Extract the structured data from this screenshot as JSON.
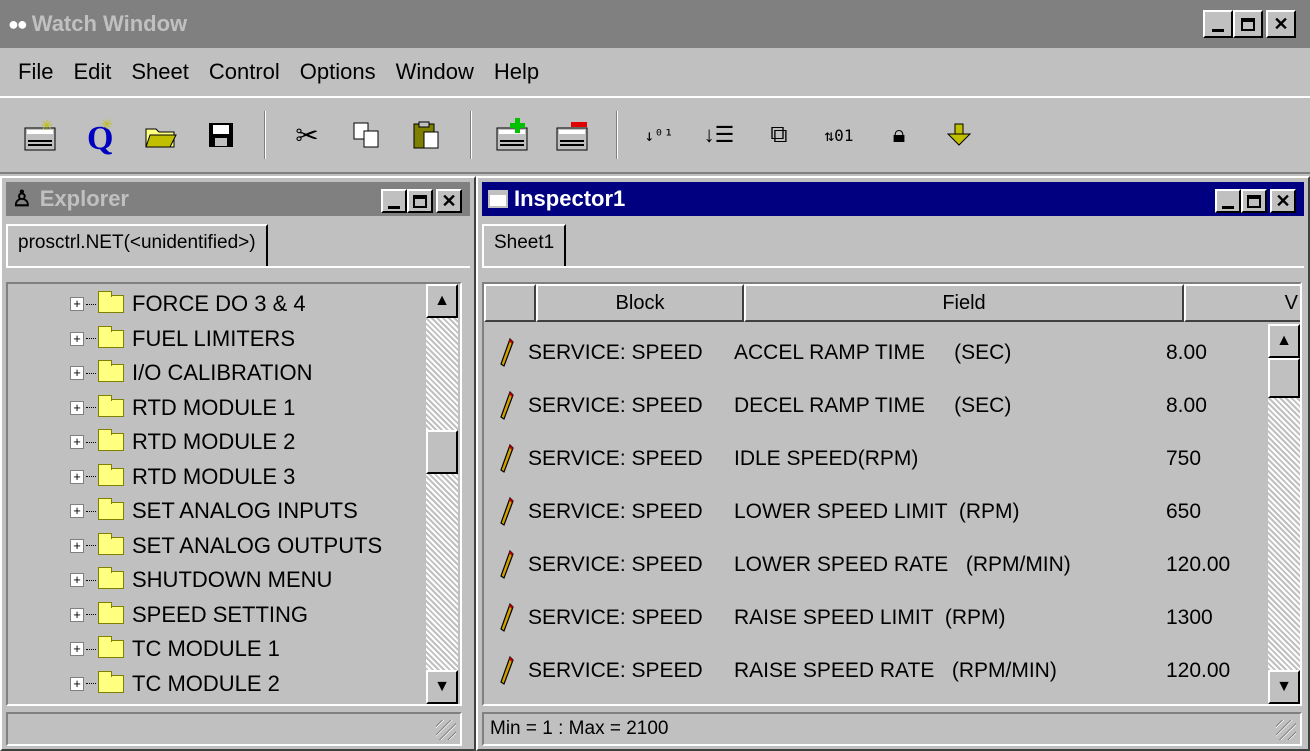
{
  "app": {
    "title": "Watch Window",
    "title_icon": "glasses-icon"
  },
  "menu": [
    {
      "label": "File"
    },
    {
      "label": "Edit"
    },
    {
      "label": "Sheet"
    },
    {
      "label": "Control"
    },
    {
      "label": "Options"
    },
    {
      "label": "Window"
    },
    {
      "label": "Help"
    }
  ],
  "toolbar": [
    "new-sheet-icon",
    "new-inspector-icon",
    "open-icon",
    "save-icon",
    "cut-icon",
    "copy-icon",
    "paste-icon",
    "add-row-icon",
    "remove-row-icon",
    "sort-ascending-icon",
    "sort-list-icon",
    "save-values-icon",
    "binary-icon",
    "lock-icon",
    "download-icon"
  ],
  "explorer": {
    "title": "Explorer",
    "tab": "prosctrl.NET(<unidentified>)",
    "items": [
      "FORCE DO 3 & 4",
      "FUEL LIMITERS",
      "I/O CALIBRATION",
      "RTD MODULE 1",
      "RTD MODULE 2",
      "RTD MODULE 3",
      "SET ANALOG INPUTS",
      "SET ANALOG OUTPUTS",
      "SHUTDOWN MENU",
      "SPEED SETTING",
      "TC MODULE 1",
      "TC MODULE 2"
    ],
    "status": ""
  },
  "inspector": {
    "title": "Inspector1",
    "tab": "Sheet1",
    "columns": {
      "block": "Block",
      "field": "Field",
      "value": "V"
    },
    "rows": [
      {
        "block": "SERVICE: SPEED",
        "field": "ACCEL RAMP TIME     (SEC)",
        "value": "8.00"
      },
      {
        "block": "SERVICE: SPEED",
        "field": "DECEL RAMP TIME     (SEC)",
        "value": "8.00"
      },
      {
        "block": "SERVICE: SPEED",
        "field": "IDLE SPEED(RPM)",
        "value": "750"
      },
      {
        "block": "SERVICE: SPEED",
        "field": "LOWER SPEED LIMIT  (RPM)",
        "value": "650"
      },
      {
        "block": "SERVICE: SPEED",
        "field": "LOWER SPEED RATE   (RPM/MIN)",
        "value": "120.00"
      },
      {
        "block": "SERVICE: SPEED",
        "field": "RAISE SPEED LIMIT  (RPM)",
        "value": "1300"
      },
      {
        "block": "SERVICE: SPEED",
        "field": "RAISE SPEED RATE   (RPM/MIN)",
        "value": "120.00"
      }
    ],
    "status": "Min = 1 : Max = 2100"
  }
}
